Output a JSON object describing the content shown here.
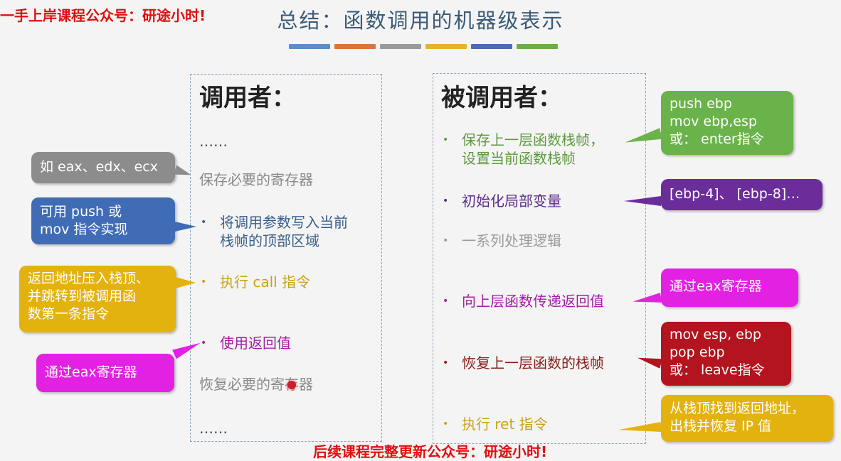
{
  "header": {
    "watermark": "一手上岸课程公众号：研途小时!",
    "title": "总结：函数调用的机器级表示",
    "bar_colors": [
      "#5b8fc4",
      "#d9763c",
      "#9a9a9a",
      "#e2b52c",
      "#4a6db0",
      "#6cae4a"
    ]
  },
  "caller": {
    "heading": "调用者：",
    "items": [
      {
        "text": "……",
        "color": "#444444"
      },
      {
        "text": "保存必要的寄存器",
        "color": "#8a8a8a"
      },
      {
        "text": "将调用参数写入当前",
        "text2": "栈帧的顶部区域",
        "color": "#3b5f8c"
      },
      {
        "text": "执行 call 指令",
        "color": "#c9a214"
      },
      {
        "text": "使用返回值",
        "color": "#a31fa3"
      },
      {
        "text": "恢复必要的寄存器",
        "color": "#8a8a8a"
      },
      {
        "text": "……",
        "color": "#444444"
      }
    ]
  },
  "callee": {
    "heading": "被调用者：",
    "items": [
      {
        "text": "保存上一层函数栈帧，",
        "text2": "设置当前函数栈帧",
        "color": "#5e9a3e"
      },
      {
        "text": "初始化局部变量",
        "color": "#5b2a8a"
      },
      {
        "text": "一系列处理逻辑",
        "color": "#9a9a9a"
      },
      {
        "text": "向上层函数传递返回值",
        "color": "#a31fa3"
      },
      {
        "text": "恢复上一层函数的栈帧",
        "color": "#8b1a1a"
      },
      {
        "text": "执行 ret 指令",
        "color": "#c9a214"
      }
    ]
  },
  "callouts": {
    "regs": {
      "lines": [
        "如 eax、edx、ecx"
      ],
      "color": "#8c8c8c"
    },
    "push_mov": {
      "lines": [
        "可用 push 或",
        "mov 指令实现"
      ],
      "color": "#3f6cb5"
    },
    "call": {
      "lines": [
        "返回地址压入栈顶、",
        "并跳转到被调用函",
        "数第一条指令"
      ],
      "color": "#e3b20e"
    },
    "eax_left": {
      "lines": [
        "通过eax寄存器"
      ],
      "color": "#e321e3"
    },
    "push_ebp": {
      "lines": [
        "push ebp",
        "mov ebp,esp",
        "或： enter指令"
      ],
      "color": "#6ab34a"
    },
    "locals": {
      "lines": [
        "[ebp-4]、 [ebp-8]…"
      ],
      "color": "#6a2d9a"
    },
    "eax_right": {
      "lines": [
        "通过eax寄存器"
      ],
      "color": "#e321e3"
    },
    "leave": {
      "lines": [
        "mov esp, ebp",
        "pop ebp",
        "或： leave指令"
      ],
      "color": "#b3141f"
    },
    "ret": {
      "lines": [
        "从栈顶找到返回地址，",
        "出栈并恢复 IP 值"
      ],
      "color": "#e3b20e"
    }
  },
  "footer": {
    "watermark": "后续课程完整更新公众号：研途小时!"
  }
}
